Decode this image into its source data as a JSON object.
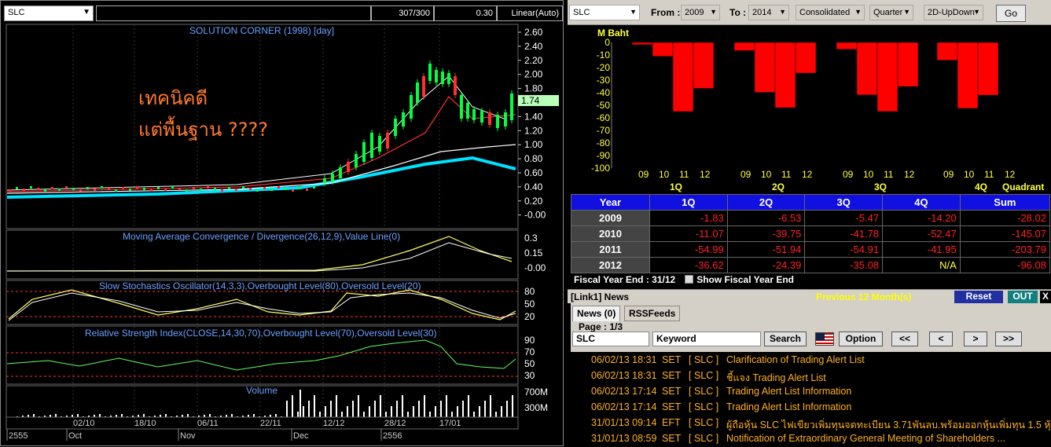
{
  "chart_window": {
    "symbol": "SLC",
    "counter": "307/300",
    "last_value": "0.30",
    "scale_mode": "Linear(Auto)",
    "title": "SOLUTION CORNER (1998) [day]",
    "annotation_line1": "เทคนิคดี",
    "annotation_line2": "แต่พื้นฐาน ????",
    "price_marker": "1.74",
    "price_axis": [
      "2.60",
      "2.40",
      "2.20",
      "2.00",
      "1.80",
      "1.60",
      "1.40",
      "1.20",
      "1.00",
      "0.80",
      "0.60",
      "0.40",
      "0.20",
      "-0.00"
    ],
    "macd_title": "Moving Average Convergence / Divergence(26,12,9),Value Line(0)",
    "macd_axis": [
      "0.3",
      "0.15",
      "-0.00"
    ],
    "stoch_title": "Slow Stochastics Oscillator(14,3,3),Overbought Level(80),Oversold Level(20)",
    "stoch_axis": [
      "80",
      "50",
      "20"
    ],
    "rsi_title": "Relative Strength Index(CLOSE,14,30,70),Overbought Level(70),Oversold Level(30)",
    "rsi_axis": [
      "90",
      "70",
      "50",
      "30"
    ],
    "volume_title": "Volume",
    "volume_axis": [
      "700M",
      "300M"
    ],
    "date_ticks": [
      "02/10",
      "18/10",
      "06/11",
      "22/11",
      "12/12",
      "28/12",
      "17/01"
    ],
    "period_labels": [
      "2555",
      "Oct",
      "Nov",
      "Dec",
      "2556"
    ]
  },
  "filter_bar": {
    "symbol": "SLC",
    "from_label": "From :",
    "from_value": "2009",
    "to_label": "To :",
    "to_value": "2014",
    "statement": "Consolidated",
    "period": "Quarter",
    "view": "2D-UpDown",
    "go_label": "Go"
  },
  "bar_chart": {
    "unit_label": "M Baht",
    "y_ticks": [
      "0",
      "-10",
      "-20",
      "-30",
      "-40",
      "-50",
      "-60",
      "-70",
      "-80",
      "-90",
      "-100"
    ],
    "year_ticks": [
      "09",
      "10",
      "11",
      "12"
    ],
    "quarter_labels": [
      "1Q",
      "2Q",
      "3Q",
      "4Q"
    ],
    "quadrant_label": "Quadrant",
    "bar_color": "#ff0000"
  },
  "chart_data": {
    "type": "bar",
    "groups": [
      "1Q",
      "2Q",
      "3Q",
      "4Q"
    ],
    "categories": [
      "09",
      "10",
      "11",
      "12"
    ],
    "series": [
      {
        "group": "1Q",
        "values": [
          -1.83,
          -11.07,
          -54.99,
          -36.62
        ]
      },
      {
        "group": "2Q",
        "values": [
          -6.53,
          -39.75,
          -51.94,
          -24.39
        ]
      },
      {
        "group": "3Q",
        "values": [
          -5.47,
          -41.78,
          -54.91,
          -35.08
        ]
      },
      {
        "group": "4Q",
        "values": [
          -14.2,
          -52.47,
          -41.95,
          null
        ]
      }
    ],
    "ylabel": "M Baht",
    "xlabel": "Quadrant",
    "ylim": [
      -100,
      0
    ]
  },
  "table": {
    "headers": [
      "Year",
      "1Q",
      "2Q",
      "3Q",
      "4Q",
      "Sum"
    ],
    "rows": [
      [
        "2009",
        "-1.83",
        "-6.53",
        "-5.47",
        "-14.20",
        "-28.02"
      ],
      [
        "2010",
        "-11.07",
        "-39.75",
        "-41.78",
        "-52.47",
        "-145.07"
      ],
      [
        "2011",
        "-54.99",
        "-51.94",
        "-54.91",
        "-41.95",
        "-203.79"
      ],
      [
        "2012",
        "-36.62",
        "-24.39",
        "-35.08",
        "N/A",
        "-96.08"
      ]
    ]
  },
  "fiscal": {
    "label": "Fiscal  Year  End  :  31/12",
    "show_label": "Show Fiscal Year End"
  },
  "news": {
    "title": "[Link1] News",
    "period": "Previous 12 Month(s)",
    "reset": "Reset",
    "out": "OUT",
    "close": "X",
    "tab_news": "News (0)",
    "tab_rss": "RSSFeeds",
    "page": "Page : 1/3",
    "symbol_value": "SLC",
    "keyword_value": "Keyword",
    "search": "Search",
    "option": "Option",
    "nav": [
      "<<",
      "<",
      ">",
      ">>"
    ],
    "items": [
      {
        "date": "06/02/13 18:31",
        "src": "SET",
        "sym": "[ SLC ]",
        "headline": "Clarification of Trading Alert List"
      },
      {
        "date": "06/02/13 18:31",
        "src": "SET",
        "sym": "[ SLC ]",
        "headline": "ชี้แจง Trading Alert List"
      },
      {
        "date": "06/02/13 17:14",
        "src": "SET",
        "sym": "[ SLC ]",
        "headline": "Trading Alert List Information"
      },
      {
        "date": "06/02/13 17:14",
        "src": "SET",
        "sym": "[ SLC ]",
        "headline": "Trading Alert List Information"
      },
      {
        "date": "31/01/13 09:14",
        "src": "EFT",
        "sym": "[ SLC ]",
        "headline": "ผู้ถือหุ้น SLC ไฟเขียวเพิ่มทุนจดทะเบียน 3.71พันลบ.พร้อมออกหุ้นเพิ่มทุน 1.5 หุ้..."
      },
      {
        "date": "31/01/13 08:59",
        "src": "SET",
        "sym": "[ SLC ]",
        "headline": "Notification of Extraordinary General Meeting of Shareholders ..."
      }
    ]
  }
}
